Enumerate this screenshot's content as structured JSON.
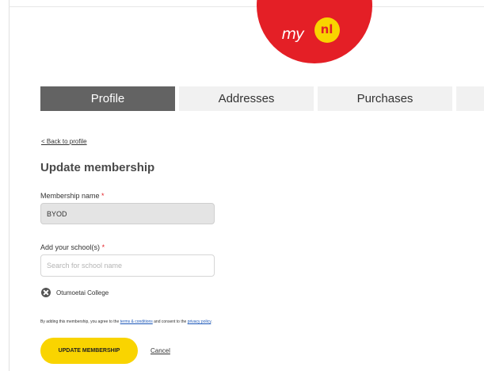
{
  "brand": {
    "logo_text": "my",
    "logo_badge": "nl",
    "colors": {
      "primary_red": "#e41f26",
      "accent_yellow": "#f9d400",
      "tab_active": "#636363"
    }
  },
  "tabs": [
    {
      "label": "Profile",
      "active": true
    },
    {
      "label": "Addresses",
      "active": false
    },
    {
      "label": "Purchases",
      "active": false
    },
    {
      "label": "",
      "active": false
    }
  ],
  "back_link": "< Back to profile",
  "page_title": "Update membership",
  "form": {
    "membership_label": "Membership name",
    "membership_value": "BYOD",
    "school_label": "Add your school(s)",
    "school_placeholder": "Search for school name",
    "required_mark": "*",
    "selected_schools": [
      {
        "name": "Otumoetai College",
        "icon": "remove-icon"
      }
    ]
  },
  "consent": {
    "prefix": "By adding this membership, you agree to the ",
    "terms_link": "terms & conditions",
    "middle": " and consent to the ",
    "privacy_link": "privacy policy",
    "suffix": "."
  },
  "actions": {
    "update_label": "UPDATE MEMBERSHIP",
    "cancel_label": "Cancel"
  }
}
